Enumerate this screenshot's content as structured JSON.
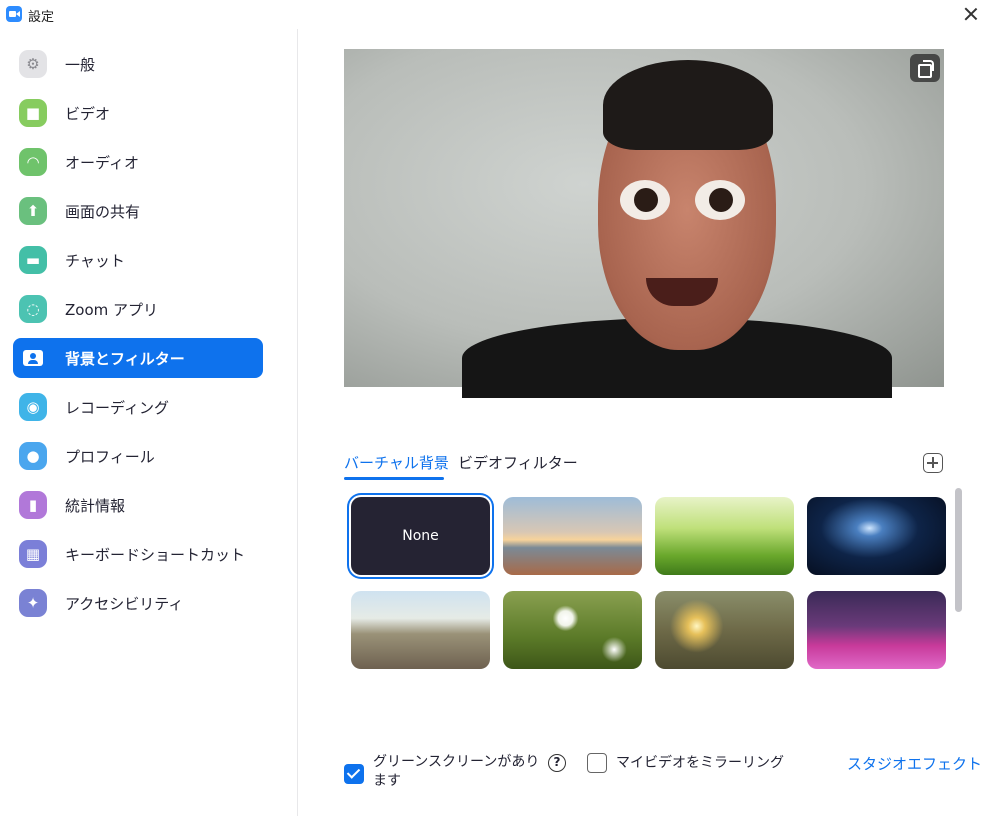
{
  "window": {
    "title": "設定",
    "app_icon": "zoom-video-icon",
    "close_icon": "close-icon"
  },
  "sidebar": {
    "items": [
      {
        "label": "一般",
        "icon": "gear-icon",
        "color": "#e3e3e6",
        "glyph": "⚙",
        "active": false
      },
      {
        "label": "ビデオ",
        "icon": "video-camera-icon",
        "color": "#87cc5f",
        "glyph": "■",
        "active": false
      },
      {
        "label": "オーディオ",
        "icon": "headphones-icon",
        "color": "#6fc36b",
        "glyph": "◠",
        "active": false
      },
      {
        "label": "画面の共有",
        "icon": "share-screen-icon",
        "color": "#6ac07e",
        "glyph": "⬆",
        "active": false
      },
      {
        "label": "チャット",
        "icon": "chat-bubble-icon",
        "color": "#43bfa7",
        "glyph": "▬",
        "active": false
      },
      {
        "label": "Zoom アプリ",
        "icon": "zoom-apps-icon",
        "color": "#4cc3b2",
        "glyph": "◌",
        "active": false
      },
      {
        "label": "背景とフィルター",
        "icon": "background-filter-icon",
        "color": "#ffffff",
        "glyph": "●",
        "active": true
      },
      {
        "label": "レコーディング",
        "icon": "record-icon",
        "color": "#3fb4e8",
        "glyph": "◉",
        "active": false
      },
      {
        "label": "プロフィール",
        "icon": "profile-icon",
        "color": "#4aa6ee",
        "glyph": "●",
        "active": false
      },
      {
        "label": "統計情報",
        "icon": "statistics-icon",
        "color": "#b178d9",
        "glyph": "▮",
        "active": false
      },
      {
        "label": "キーボードショートカット",
        "icon": "keyboard-icon",
        "color": "#7b7fd8",
        "glyph": "▦",
        "active": false
      },
      {
        "label": "アクセシビリティ",
        "icon": "accessibility-icon",
        "color": "#7a82d4",
        "glyph": "✦",
        "active": false
      }
    ]
  },
  "main": {
    "tabs": [
      {
        "label": "バーチャル背景",
        "active": true
      },
      {
        "label": "ビデオフィルター",
        "active": false
      }
    ],
    "backgrounds": [
      {
        "name": "none",
        "label": "None",
        "selected": true
      },
      {
        "name": "golden-gate-bridge",
        "label": "",
        "selected": false
      },
      {
        "name": "grass",
        "label": "",
        "selected": false
      },
      {
        "name": "earth-from-space",
        "label": "",
        "selected": false
      },
      {
        "name": "farmhouse",
        "label": "",
        "selected": false
      },
      {
        "name": "white-flowers",
        "label": "",
        "selected": false
      },
      {
        "name": "sunset-sea",
        "label": "",
        "selected": false
      },
      {
        "name": "studio-set",
        "label": "",
        "selected": false
      }
    ],
    "green_screen": {
      "label": "グリーンスクリーンがあります",
      "checked": true
    },
    "mirror_video": {
      "label": "マイビデオをミラーリング",
      "checked": false
    },
    "studio_effects_link": "スタジオエフェクト",
    "help_glyph": "?",
    "accent_color": "#0e72ed"
  }
}
